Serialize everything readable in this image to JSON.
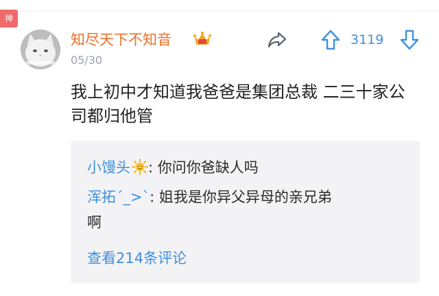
{
  "badge": {
    "label": "神"
  },
  "post": {
    "username": "知尽天下不知音",
    "date": "05/30",
    "vote_count": "3119",
    "text": "我上初中才知道我爸爸是集团总裁 二三十家公司都归他管"
  },
  "comments": [
    {
      "author": "小馒头",
      "text": ": 你问你爸缺人吗"
    },
    {
      "author": "浑拓´_>`",
      "text": ": 姐我是你异父异母的亲兄弟",
      "text_cont": "啊"
    }
  ],
  "view_more_label": "查看214条评论",
  "icons": {
    "crown": "crown-badge-icon",
    "share": "share-arrow-icon",
    "upvote": "up-arrow-icon",
    "downvote": "down-arrow-icon",
    "sun": "sun-emoji-icon"
  },
  "colors": {
    "username": "#e8722e",
    "link_blue": "#3f8fde",
    "date_gray": "#9aa1aa",
    "comment_bg": "#f3f3f6",
    "badge_red": "#f06a6a"
  }
}
